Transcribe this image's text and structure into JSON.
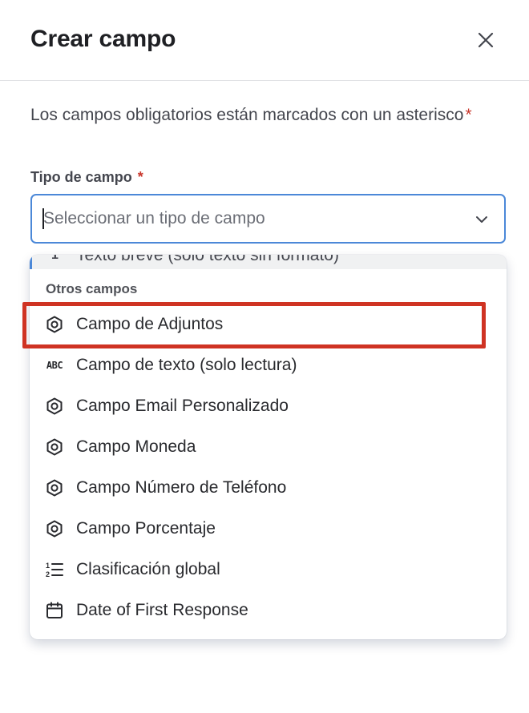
{
  "dialog": {
    "title": "Crear campo",
    "close_icon": "close-icon"
  },
  "form": {
    "intro_text": "Los campos obligatorios están marcados con un asterisco",
    "required_marker": "*",
    "field_type": {
      "label": "Tipo de campo",
      "placeholder": "Seleccionar un tipo de campo",
      "value": ""
    }
  },
  "dropdown": {
    "partial_option": {
      "label": "Texto breve (solo texto sin formato)",
      "icon": "short-text-icon"
    },
    "group_heading": "Otros campos",
    "options": [
      {
        "label": "Campo de Adjuntos",
        "icon": "hexagon-icon"
      },
      {
        "label": "Campo de texto (solo lectura)",
        "icon": "abc-icon"
      },
      {
        "label": "Campo Email Personalizado",
        "icon": "hexagon-icon"
      },
      {
        "label": "Campo Moneda",
        "icon": "hexagon-icon"
      },
      {
        "label": "Campo Número de Teléfono",
        "icon": "hexagon-icon"
      },
      {
        "label": "Campo Porcentaje",
        "icon": "hexagon-icon"
      },
      {
        "label": "Clasificación global",
        "icon": "ranked-list-icon"
      },
      {
        "label": "Date of First Response",
        "icon": "calendar-icon"
      }
    ]
  },
  "annotation": {
    "highlighted_option": "Campo de Adjuntos",
    "color": "#cf3323"
  },
  "colors": {
    "focus_border": "#4b88d8",
    "required": "#c9372c"
  }
}
